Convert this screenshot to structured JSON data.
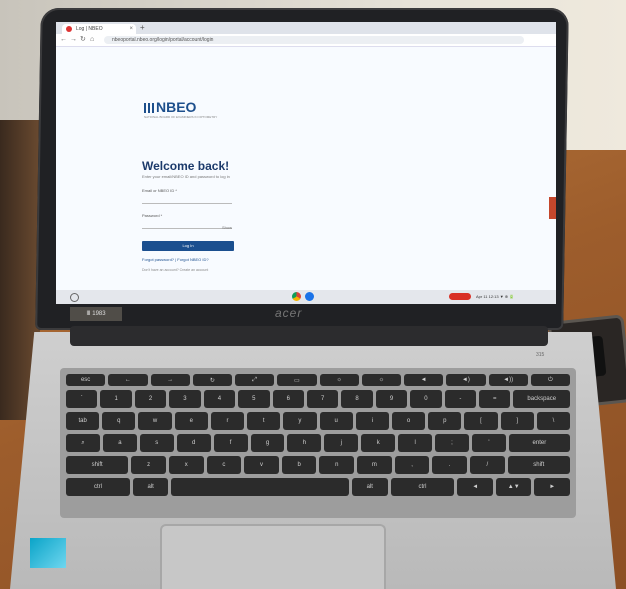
{
  "browser": {
    "tab_title": "Log | NBEO",
    "tab_close": "×",
    "new_tab": "+",
    "nav": [
      "←",
      "→",
      "↻",
      "⌂"
    ],
    "url": "nbeoportal.nbeo.org/login/portal/account/login"
  },
  "login_page": {
    "brand": "NBEO",
    "tagline": "NATIONAL BOARD OF EXAMINERS IN OPTOMETRY",
    "heading": "Welcome back!",
    "subtitle": "Enter your email/NBEO ID and password to log in",
    "email_label": "Email or NBEO ID *",
    "password_label": "Password *",
    "show_label": "Show",
    "login_button": "Log In",
    "links": "Forgot password?  |  Forgot NBEO ID?",
    "create_account": "Don't have an account?  Create an account"
  },
  "taskbar": {
    "tray_text": "Apr 11  12:13 ▼ ⊕ 🔋"
  },
  "laptop": {
    "brand": "acer",
    "sticker": "Ⅲ 1983",
    "model": "315"
  },
  "keyboard": {
    "rows": [
      [
        "esc",
        "←",
        "→",
        "↻",
        "⤢",
        "▭",
        "☼",
        "☼",
        "◄",
        "◄)",
        "◄))",
        "⏻"
      ],
      [
        "`",
        "1",
        "2",
        "3",
        "4",
        "5",
        "6",
        "7",
        "8",
        "9",
        "0",
        "-",
        "=",
        "backspace"
      ],
      [
        "tab",
        "q",
        "w",
        "e",
        "r",
        "t",
        "y",
        "u",
        "i",
        "o",
        "p",
        "[",
        "]",
        "\\"
      ],
      [
        "⌕",
        "a",
        "s",
        "d",
        "f",
        "g",
        "h",
        "j",
        "k",
        "l",
        ";",
        "'",
        "enter"
      ],
      [
        "shift",
        "z",
        "x",
        "c",
        "v",
        "b",
        "n",
        "m",
        ",",
        ".",
        "/",
        "shift"
      ],
      [
        "ctrl",
        "alt",
        "",
        "alt",
        "ctrl",
        "◄",
        "▲▼",
        "►"
      ]
    ]
  },
  "colors": {
    "brand_blue": "#1b4f8f",
    "feedback_tab": "#c4472c"
  }
}
